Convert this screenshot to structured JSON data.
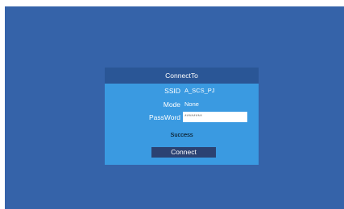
{
  "dialog": {
    "title": "ConnectTo",
    "ssid_label": "SSID",
    "ssid_value": "A_SCS_PJ",
    "mode_label": "Mode",
    "mode_value": "None",
    "password_label": "PassWord",
    "password_value": "********",
    "status_text": "Success",
    "connect_label": "Connect"
  },
  "colors": {
    "background": "#3563a9",
    "dialog_body": "#3a9ae1",
    "title_bar": "#2a5696",
    "button": "#2b4272"
  }
}
